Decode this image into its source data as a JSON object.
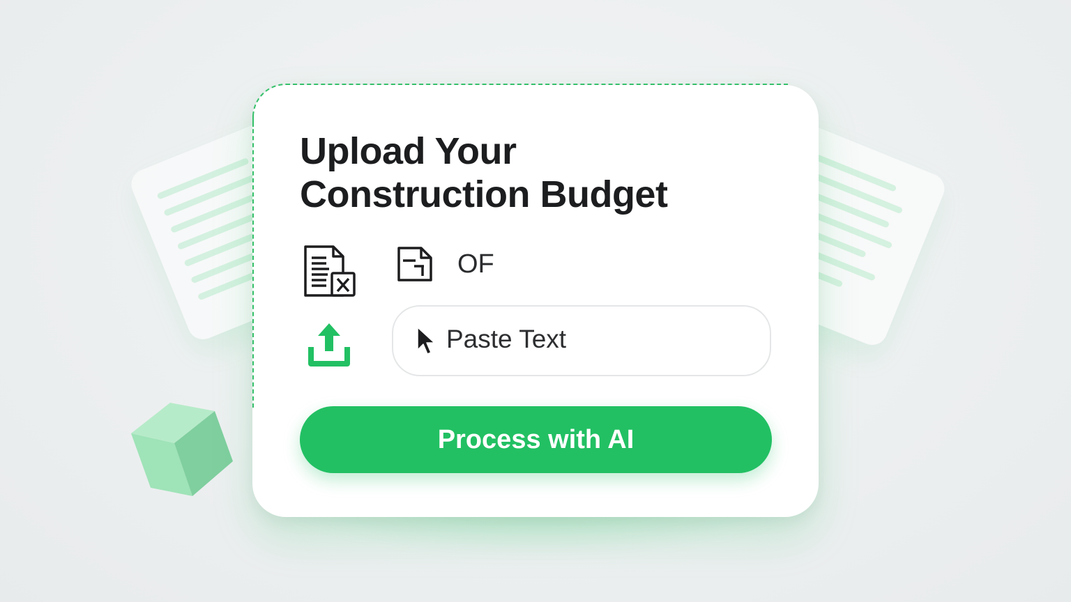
{
  "card": {
    "title_line1": "Upload Your",
    "title_line2": "Construction Budget",
    "or_label": "OF",
    "paste_label": "Paste Text",
    "process_button_label": "Process with AI"
  },
  "icons": {
    "excel_file": "excel-file-icon",
    "document": "document-icon",
    "upload": "upload-icon",
    "cursor": "mouse-cursor-icon"
  },
  "colors": {
    "accent_green": "#22c063",
    "text_dark": "#1c1d1f",
    "background": "#eceff0"
  }
}
